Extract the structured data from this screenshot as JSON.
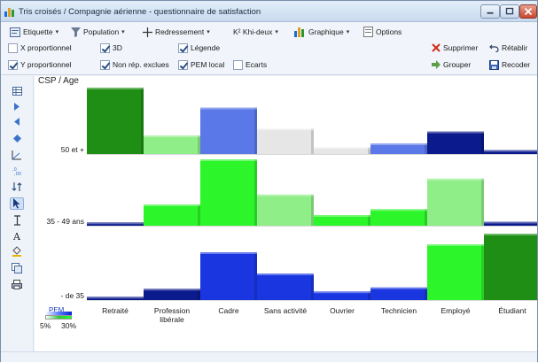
{
  "window": {
    "title": "Tris croisés / Compagnie aérienne - questionnaire de satisfaction",
    "icon": "cross-table-app-icon"
  },
  "toolbar": {
    "row1": [
      {
        "label": "Etiquette",
        "icon": "label-icon",
        "dropdown": true
      },
      {
        "label": "Population",
        "icon": "filter-icon",
        "dropdown": true
      },
      {
        "label": "Redressement",
        "icon": "weighting-icon",
        "dropdown": true
      },
      {
        "label": "K² Khi-deux",
        "icon": "",
        "dropdown": true
      },
      {
        "label": "Graphique",
        "icon": "bar-chart-icon",
        "dropdown": true
      },
      {
        "label": "Options",
        "icon": "options-icon",
        "dropdown": false
      }
    ],
    "checkboxes_row2": [
      {
        "label": "X proportionnel",
        "checked": false
      },
      {
        "label": "3D",
        "checked": true
      },
      {
        "label": "Légende",
        "checked": true
      }
    ],
    "checkboxes_row3": [
      {
        "label": "Y proportionnel",
        "checked": true
      },
      {
        "label": "Non rép. exclues",
        "checked": true
      },
      {
        "label": "PEM local",
        "checked": true
      },
      {
        "label": "Ecarts",
        "checked": false
      }
    ],
    "actions": {
      "supprimer": "Supprimer",
      "retablir": "Rétablir",
      "grouper": "Grouper",
      "recoder": "Recoder"
    }
  },
  "sidebar_tools": [
    "table-icon",
    "play-right-icon",
    "play-left-icon",
    "diamond-icon",
    "axis-angle-icon",
    "decimal-icon",
    "sort-icon",
    "pointer-icon",
    "text-cursor-icon",
    "font-icon",
    "fill-bucket-icon",
    "copy-icon",
    "print-icon"
  ],
  "chart_data": {
    "type": "bar",
    "title": "CSP / Age",
    "rows": [
      "50 et +",
      "35 - 49 ans",
      "- de 35"
    ],
    "categories": [
      "Retraité",
      "Profession libérale",
      "Cadre",
      "Sans activité",
      "Ouvrier",
      "Technicien",
      "Employé",
      "Étudiant"
    ],
    "series": [
      {
        "name": "50 et +",
        "values": [
          100,
          28,
          70,
          38,
          10,
          16,
          34,
          6
        ]
      },
      {
        "name": "35 - 49 ans",
        "values": [
          5,
          32,
          100,
          47,
          16,
          25,
          71,
          6
        ]
      },
      {
        "name": "- de 35",
        "values": [
          5,
          17,
          72,
          40,
          13,
          19,
          84,
          100
        ]
      }
    ],
    "legend": {
      "title": "PEM",
      "min": "5%",
      "max": "30%"
    }
  },
  "colors": {
    "dark_green": "#1e8f14",
    "light_green": "#90ee88",
    "bright_green": "#2cf52a",
    "dark_blue": "#0b1a8c",
    "blue": "#1a36e0",
    "light_blue": "#5b78e8",
    "gray": "#e6e6e6"
  }
}
